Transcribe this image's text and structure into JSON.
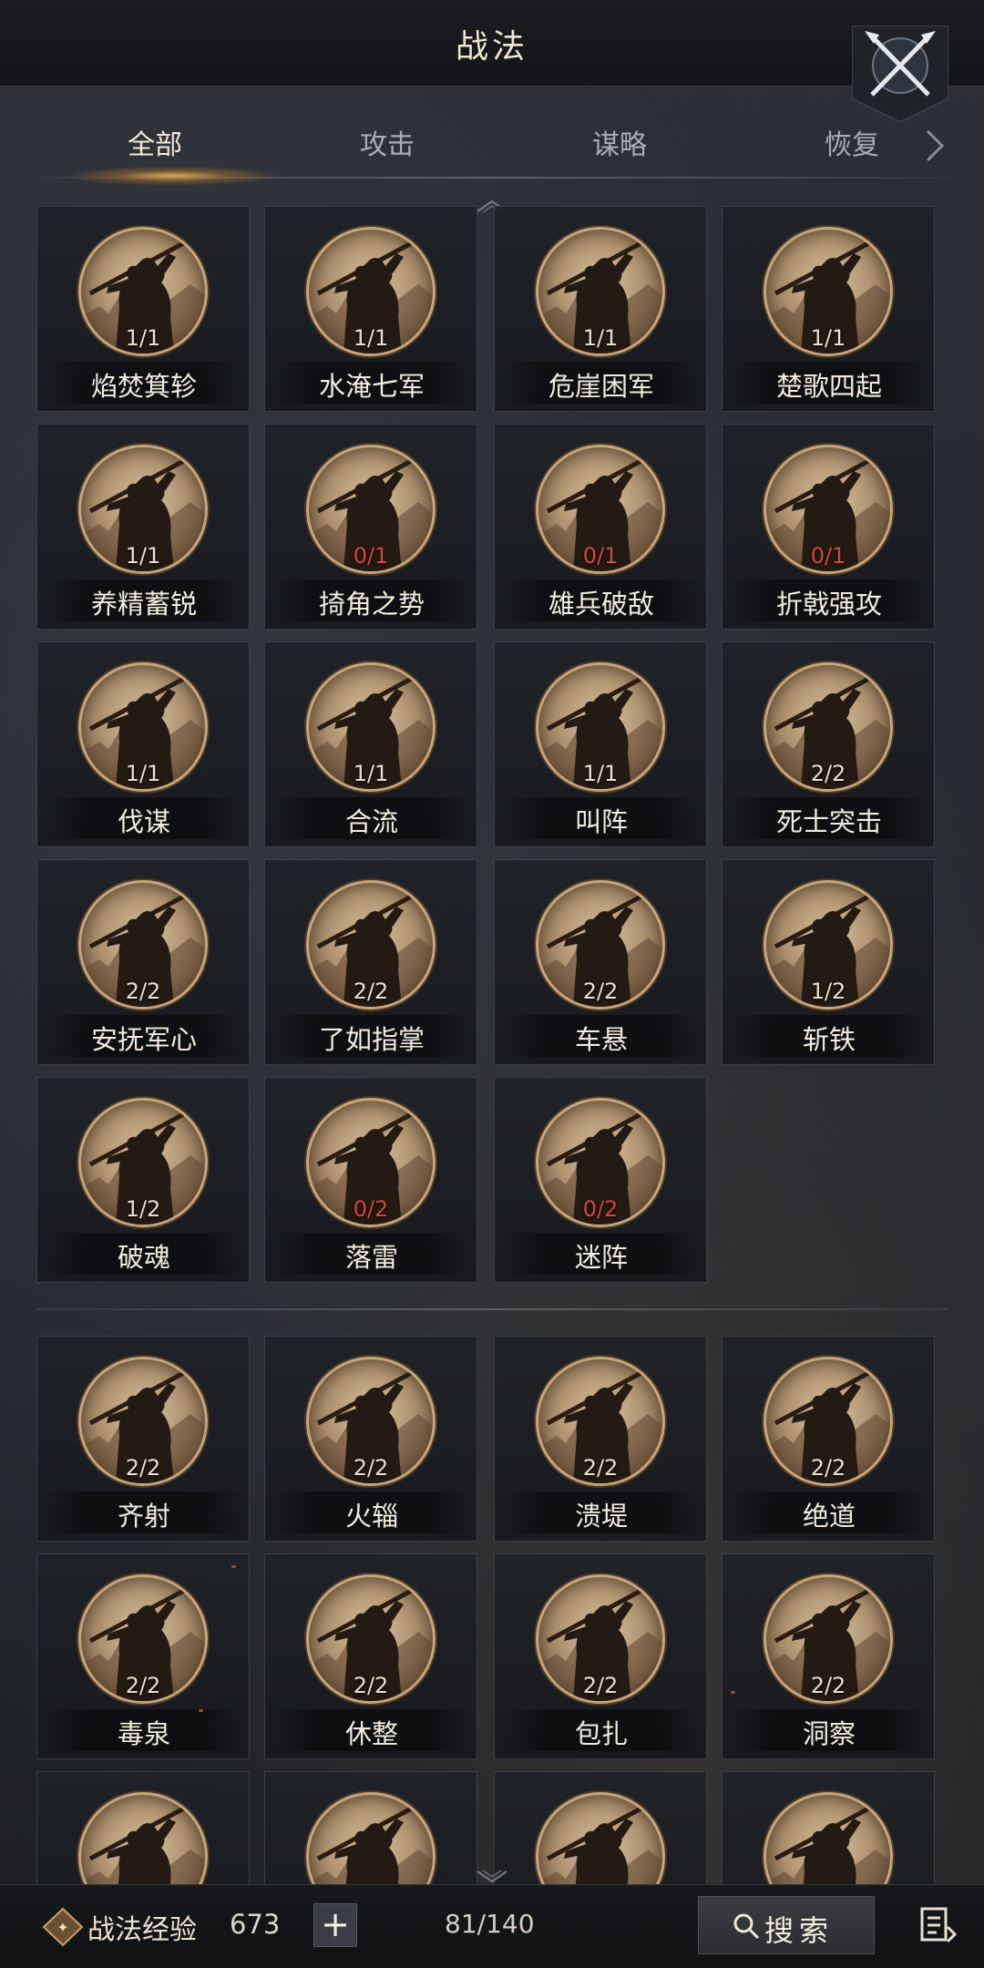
{
  "header": {
    "title": "战法"
  },
  "tabs": [
    {
      "label": "全部",
      "active": true
    },
    {
      "label": "攻击",
      "active": false
    },
    {
      "label": "谋略",
      "active": false
    },
    {
      "label": "恢复",
      "active": false
    }
  ],
  "section1": {
    "cards": [
      {
        "name": "焰焚箕轸",
        "count": "1/1",
        "red": false
      },
      {
        "name": "水淹七军",
        "count": "1/1",
        "red": false
      },
      {
        "name": "危崖困军",
        "count": "1/1",
        "red": false
      },
      {
        "name": "楚歌四起",
        "count": "1/1",
        "red": false
      },
      {
        "name": "养精蓄锐",
        "count": "1/1",
        "red": false
      },
      {
        "name": "掎角之势",
        "count": "0/1",
        "red": true
      },
      {
        "name": "雄兵破敌",
        "count": "0/1",
        "red": true
      },
      {
        "name": "折戟强攻",
        "count": "0/1",
        "red": true
      },
      {
        "name": "伐谋",
        "count": "1/1",
        "red": false
      },
      {
        "name": "合流",
        "count": "1/1",
        "red": false
      },
      {
        "name": "叫阵",
        "count": "1/1",
        "red": false
      },
      {
        "name": "死士突击",
        "count": "2/2",
        "red": false
      },
      {
        "name": "安抚军心",
        "count": "2/2",
        "red": false
      },
      {
        "name": "了如指掌",
        "count": "2/2",
        "red": false
      },
      {
        "name": "车悬",
        "count": "2/2",
        "red": false
      },
      {
        "name": "斩铁",
        "count": "1/2",
        "red": false
      },
      {
        "name": "破魂",
        "count": "1/2",
        "red": false
      },
      {
        "name": "落雷",
        "count": "0/2",
        "red": true
      },
      {
        "name": "迷阵",
        "count": "0/2",
        "red": true
      }
    ]
  },
  "section2": {
    "cards": [
      {
        "name": "齐射",
        "count": "2/2",
        "red": false
      },
      {
        "name": "火辎",
        "count": "2/2",
        "red": false
      },
      {
        "name": "溃堤",
        "count": "2/2",
        "red": false
      },
      {
        "name": "绝道",
        "count": "2/2",
        "red": false
      },
      {
        "name": "毒泉",
        "count": "2/2",
        "red": false
      },
      {
        "name": "休整",
        "count": "2/2",
        "red": false
      },
      {
        "name": "包扎",
        "count": "2/2",
        "red": false
      },
      {
        "name": "洞察",
        "count": "2/2",
        "red": false
      },
      {
        "name": "",
        "count": "",
        "red": false
      },
      {
        "name": "",
        "count": "",
        "red": false
      },
      {
        "name": "",
        "count": "",
        "red": false
      },
      {
        "name": "",
        "count": "",
        "red": false
      }
    ]
  },
  "bottom": {
    "exp_label": "战法经验",
    "exp_value": "673",
    "plus_label": "+",
    "capacity": "81/140",
    "search_label": "搜索"
  },
  "icons": {
    "emblem": "crossed-swords-emblem-icon",
    "tab_next": "chevron-right-icon",
    "scroll_up": "chevron-up-icon",
    "scroll_down": "chevron-down-icon",
    "exp": "tactic-exp-icon",
    "search": "search-icon",
    "list": "list-icon"
  },
  "colors": {
    "accent": "#f0a640",
    "red_count": "#d8463c",
    "card_border": "#3b3f45"
  }
}
